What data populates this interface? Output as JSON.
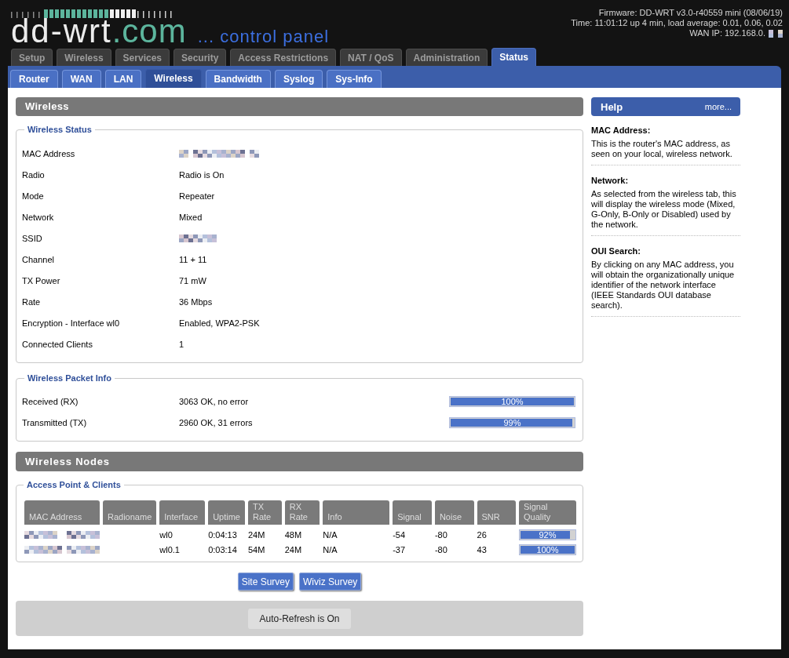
{
  "header": {
    "logo": {
      "name": "dd-wrt",
      "domain": ".com"
    },
    "tagline": "... control panel",
    "info": [
      {
        "text": "Firmware: DD-WRT v3.0-r40559 mini (08/06/19)",
        "redacted": false
      },
      {
        "text": "Time: 11:01:12 up 4 min, load average: 0.01, 0.06, 0.02",
        "redacted": false
      },
      {
        "text": "WAN IP: 192.168.0.",
        "redacted": true
      }
    ]
  },
  "main_tabs": [
    {
      "label": "Setup",
      "selected": false
    },
    {
      "label": "Wireless",
      "selected": false
    },
    {
      "label": "Services",
      "selected": false
    },
    {
      "label": "Security",
      "selected": false
    },
    {
      "label": "Access Restrictions",
      "selected": false
    },
    {
      "label": "NAT / QoS",
      "selected": false
    },
    {
      "label": "Administration",
      "selected": false
    },
    {
      "label": "Status",
      "selected": true
    }
  ],
  "sub_tabs": [
    {
      "label": "Router",
      "selected": false
    },
    {
      "label": "WAN",
      "selected": false
    },
    {
      "label": "LAN",
      "selected": false
    },
    {
      "label": "Wireless",
      "selected": true
    },
    {
      "label": "Bandwidth",
      "selected": false
    },
    {
      "label": "Syslog",
      "selected": false
    },
    {
      "label": "Sys-Info",
      "selected": false
    }
  ],
  "wireless": {
    "title": "Wireless",
    "status": {
      "legend": "Wireless Status",
      "rows": [
        {
          "label": "MAC Address",
          "kind": "redacted"
        },
        {
          "label": "Radio",
          "kind": "text",
          "value": "Radio is On"
        },
        {
          "label": "Mode",
          "kind": "text",
          "value": "Repeater"
        },
        {
          "label": "Network",
          "kind": "text",
          "value": "Mixed"
        },
        {
          "label": "SSID",
          "kind": "redacted"
        },
        {
          "label": "Channel",
          "kind": "text",
          "value": "11 + 11"
        },
        {
          "label": "TX Power",
          "kind": "text",
          "value": "71 mW"
        },
        {
          "label": "Rate",
          "kind": "text",
          "value": "36 Mbps"
        },
        {
          "label": "Encryption - Interface wl0",
          "kind": "text",
          "value": "Enabled, WPA2-PSK"
        },
        {
          "label": "Connected Clients",
          "kind": "text",
          "value": "1"
        }
      ]
    },
    "packet_info": {
      "legend": "Wireless Packet Info",
      "rows": [
        {
          "label": "Received (RX)",
          "value": "3063 OK, no error",
          "level": 1,
          "reading": "100%"
        },
        {
          "label": "Transmitted (TX)",
          "value": "2960 OK, 31 errors",
          "level": 0.99,
          "reading": "99%"
        }
      ]
    }
  },
  "nodes": {
    "title": "Wireless Nodes",
    "legend": "Access Point & Clients",
    "columns": [
      "MAC Address",
      "Radioname",
      "Interface",
      "Uptime",
      "TX Rate",
      "RX Rate",
      "Info",
      "Signal",
      "Noise",
      "SNR",
      "Signal Quality"
    ],
    "rows": [
      {
        "mac_redacted": true,
        "interface": "wl0",
        "uptime": "0:04:13",
        "tx_rate": "24M",
        "rx_rate": "48M",
        "info": "N/A",
        "signal": "-54",
        "noise": "-80",
        "snr": "26",
        "quality": {
          "level": 0.92,
          "reading": "92%"
        }
      },
      {
        "mac_redacted": true,
        "interface": "wl0.1",
        "uptime": "0:03:14",
        "tx_rate": "54M",
        "rx_rate": "24M",
        "info": "N/A",
        "signal": "-37",
        "noise": "-80",
        "snr": "43",
        "quality": {
          "level": 1,
          "reading": "100%"
        }
      }
    ]
  },
  "buttons": [
    "Site Survey",
    "Wiviz Survey"
  ],
  "auto_refresh": "Auto-Refresh is On",
  "help": {
    "title": "Help",
    "more": "more...",
    "entries": [
      {
        "title": "MAC Address:",
        "text": "This is the router's MAC address, as seen on your local, wireless network."
      },
      {
        "title": "Network:",
        "text": "As selected from the wireless tab, this will display the wireless mode (Mixed, G-Only, B-Only or Disabled) used by the network."
      },
      {
        "title": "OUI Search:",
        "text": "By clicking on any MAC address, you will obtain the organizationally unique identifier of the network interface (IEEE Standards OUI database search)."
      }
    ]
  }
}
